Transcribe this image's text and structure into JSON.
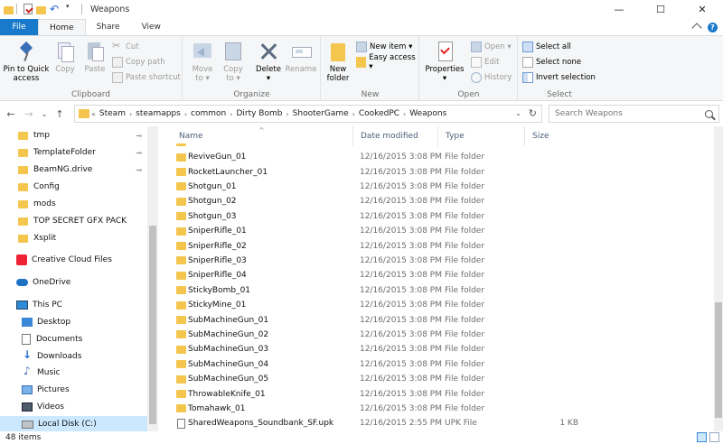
{
  "window": {
    "title": "Weapons",
    "minimize": "—",
    "maximize": "☐",
    "close": "✕"
  },
  "ribbon_tabs": [
    "File",
    "Home",
    "Share",
    "View"
  ],
  "ribbon": {
    "clipboard": {
      "label": "Clipboard",
      "pin": [
        "Pin to Quick",
        "access"
      ],
      "copy": "Copy",
      "paste": "Paste",
      "cut": "Cut",
      "copy_path": "Copy path",
      "paste_shortcut": "Paste shortcut"
    },
    "organize": {
      "label": "Organize",
      "move_to": [
        "Move",
        "to ▾"
      ],
      "copy_to": [
        "Copy",
        "to ▾"
      ],
      "delete": [
        "Delete",
        "▾"
      ],
      "rename": "Rename"
    },
    "new": {
      "label": "New",
      "new_folder": [
        "New",
        "folder"
      ],
      "new_item": "New item ▾",
      "easy_access": "Easy access ▾"
    },
    "open": {
      "label": "Open",
      "properties": [
        "Properties",
        "▾"
      ],
      "open": "Open ▾",
      "edit": "Edit",
      "history": "History"
    },
    "select": {
      "label": "Select",
      "select_all": "Select all",
      "select_none": "Select none",
      "invert": "Invert selection"
    }
  },
  "nav": {
    "back": "←",
    "forward": "→",
    "recent": "⌄",
    "up": "↑",
    "overflow": "«",
    "breadcrumbs": [
      "Steam",
      "steamapps",
      "common",
      "Dirty Bomb",
      "ShooterGame",
      "CookedPC",
      "Weapons"
    ],
    "breadcrumb_sep": "›",
    "dropdown": "⌄",
    "refresh": "↻",
    "search_placeholder": "Search Weapons"
  },
  "sidebar": {
    "quick_access": [
      {
        "label": "tmp",
        "pinned": true
      },
      {
        "label": "TemplateFolder",
        "pinned": true
      },
      {
        "label": "BeamNG.drive",
        "pinned": true
      },
      {
        "label": "Config",
        "pinned": false
      },
      {
        "label": "mods",
        "pinned": false
      },
      {
        "label": "TOP SECRET GFX PACK",
        "pinned": false
      },
      {
        "label": "Xsplit",
        "pinned": false
      }
    ],
    "pin_glyph": "📌",
    "creative_cloud": "Creative Cloud Files",
    "onedrive": "OneDrive",
    "this_pc": "This PC",
    "pc_items": [
      "Desktop",
      "Documents",
      "Downloads",
      "Music",
      "Pictures",
      "Videos",
      "Local Disk (C:)"
    ]
  },
  "columns": {
    "name": "Name",
    "date": "Date modified",
    "type": "Type",
    "size": "Size",
    "sort_glyph": "^"
  },
  "files": [
    {
      "name": "ReviveGun_01",
      "date": "12/16/2015 3:08 PM",
      "type": "File folder",
      "size": "",
      "kind": "folder"
    },
    {
      "name": "RocketLauncher_01",
      "date": "12/16/2015 3:08 PM",
      "type": "File folder",
      "size": "",
      "kind": "folder"
    },
    {
      "name": "Shotgun_01",
      "date": "12/16/2015 3:08 PM",
      "type": "File folder",
      "size": "",
      "kind": "folder"
    },
    {
      "name": "Shotgun_02",
      "date": "12/16/2015 3:08 PM",
      "type": "File folder",
      "size": "",
      "kind": "folder"
    },
    {
      "name": "Shotgun_03",
      "date": "12/16/2015 3:08 PM",
      "type": "File folder",
      "size": "",
      "kind": "folder"
    },
    {
      "name": "SniperRifle_01",
      "date": "12/16/2015 3:08 PM",
      "type": "File folder",
      "size": "",
      "kind": "folder"
    },
    {
      "name": "SniperRifle_02",
      "date": "12/16/2015 3:08 PM",
      "type": "File folder",
      "size": "",
      "kind": "folder"
    },
    {
      "name": "SniperRifle_03",
      "date": "12/16/2015 3:08 PM",
      "type": "File folder",
      "size": "",
      "kind": "folder"
    },
    {
      "name": "SniperRifle_04",
      "date": "12/16/2015 3:08 PM",
      "type": "File folder",
      "size": "",
      "kind": "folder"
    },
    {
      "name": "StickyBomb_01",
      "date": "12/16/2015 3:08 PM",
      "type": "File folder",
      "size": "",
      "kind": "folder"
    },
    {
      "name": "StickyMine_01",
      "date": "12/16/2015 3:08 PM",
      "type": "File folder",
      "size": "",
      "kind": "folder"
    },
    {
      "name": "SubMachineGun_01",
      "date": "12/16/2015 3:08 PM",
      "type": "File folder",
      "size": "",
      "kind": "folder"
    },
    {
      "name": "SubMachineGun_02",
      "date": "12/16/2015 3:08 PM",
      "type": "File folder",
      "size": "",
      "kind": "folder"
    },
    {
      "name": "SubMachineGun_03",
      "date": "12/16/2015 3:08 PM",
      "type": "File folder",
      "size": "",
      "kind": "folder"
    },
    {
      "name": "SubMachineGun_04",
      "date": "12/16/2015 3:08 PM",
      "type": "File folder",
      "size": "",
      "kind": "folder"
    },
    {
      "name": "SubMachineGun_05",
      "date": "12/16/2015 3:08 PM",
      "type": "File folder",
      "size": "",
      "kind": "folder"
    },
    {
      "name": "ThrowableKnife_01",
      "date": "12/16/2015 3:08 PM",
      "type": "File folder",
      "size": "",
      "kind": "folder"
    },
    {
      "name": "Tomahawk_01",
      "date": "12/16/2015 3:08 PM",
      "type": "File folder",
      "size": "",
      "kind": "folder"
    },
    {
      "name": "SharedWeapons_Soundbank_SF.upk",
      "date": "12/16/2015 2:55 PM",
      "type": "UPK File",
      "size": "1 KB",
      "kind": "file"
    }
  ],
  "status": {
    "item_count": "48 items"
  }
}
